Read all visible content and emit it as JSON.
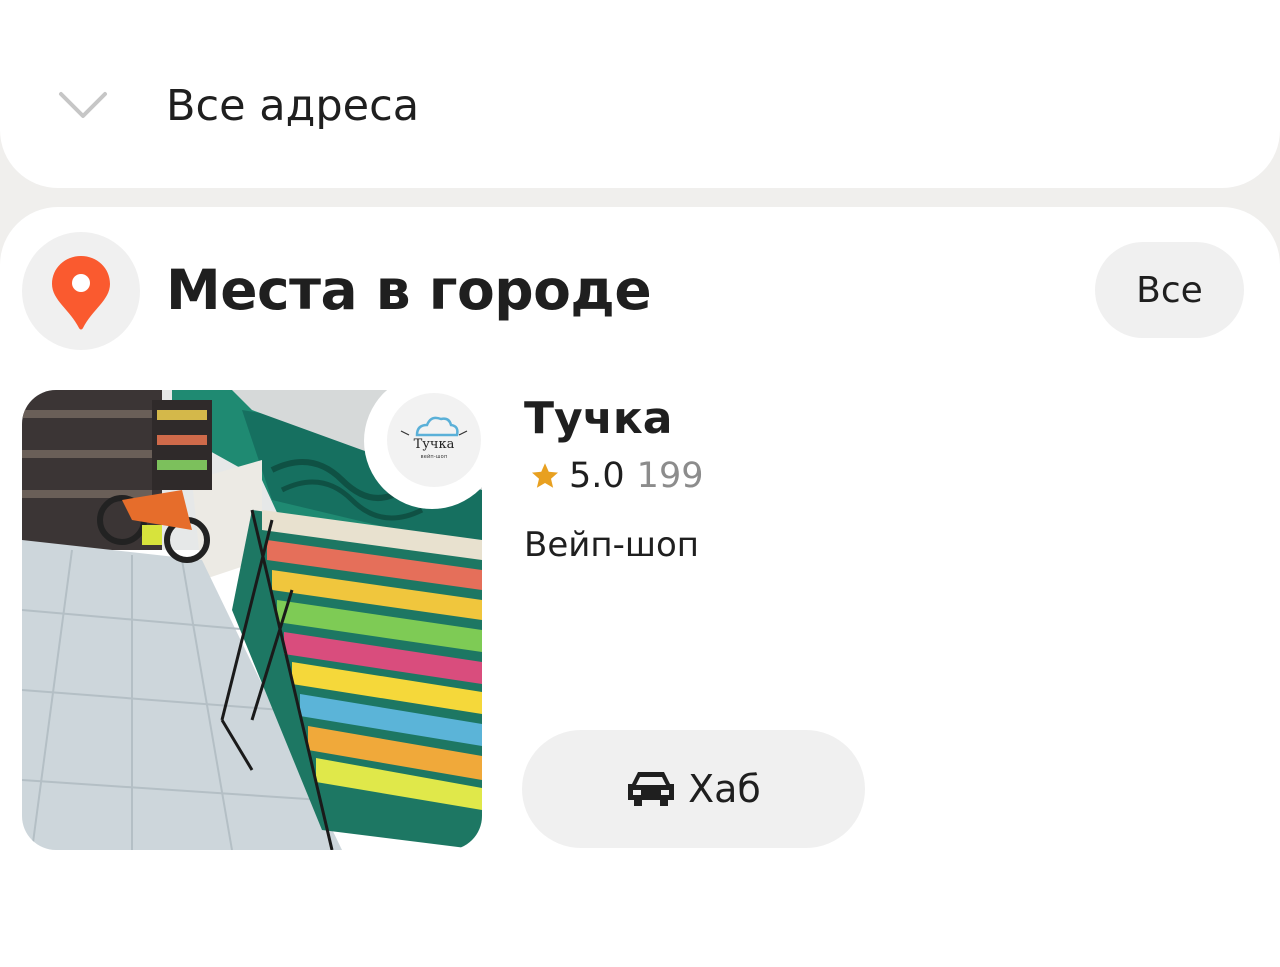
{
  "header": {
    "title": "Все адреса",
    "icon": "chevron-down-icon"
  },
  "section": {
    "title": "Места в городе",
    "icon": "map-pin-icon",
    "all_button_label": "Все",
    "accent_color": "#fa5a2f"
  },
  "place": {
    "name": "Тучка",
    "rating": "5.0",
    "reviews_count": "199",
    "category": "Вейп-шоп",
    "photo_description": "photo-interior",
    "logo": {
      "text": "Тучка",
      "subtitle": "вейп-шоп"
    },
    "star_color": "#e8a020",
    "taxi_button_label": "Хаб",
    "taxi_icon": "taxi-car-icon"
  }
}
